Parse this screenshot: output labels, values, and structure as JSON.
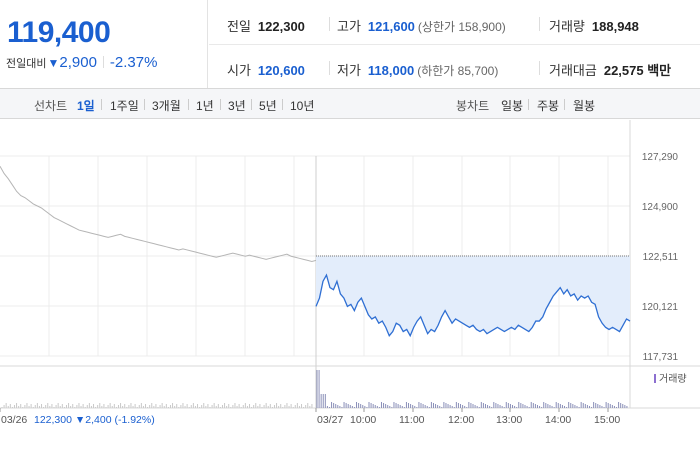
{
  "quote": {
    "price": "119,400",
    "change_label": "전일대비",
    "change_arrow": "▼",
    "change_amount": "2,900",
    "change_percent": "-2.37%"
  },
  "stats": {
    "prev_close": {
      "label": "전일",
      "value": "122,300"
    },
    "high": {
      "label": "고가",
      "value": "121,600",
      "sub": "(상한가 158,900)"
    },
    "volume": {
      "label": "거래량",
      "value": "188,948"
    },
    "open": {
      "label": "시가",
      "value": "120,600"
    },
    "low": {
      "label": "저가",
      "value": "118,000",
      "sub": "(하한가 85,700)"
    },
    "trade_value": {
      "label": "거래대금",
      "value": "22,575 백만"
    }
  },
  "period_bar": {
    "line_label": "선차트",
    "line_options": [
      "1일",
      "1주일",
      "3개월",
      "1년",
      "3년",
      "5년",
      "10년"
    ],
    "active_line_option": "1일",
    "candle_label": "봉차트",
    "candle_options": [
      "일봉",
      "주봉",
      "월봉"
    ]
  },
  "chart_data": {
    "type": "line",
    "y_ticks": [
      "127,290",
      "124,900",
      "122,511",
      "120,121",
      "117,731"
    ],
    "ylim": [
      117731,
      127290
    ],
    "reference_line": 122511,
    "x_labels": [
      "03/26",
      "03/27",
      "10:00",
      "11:00",
      "12:00",
      "13:00",
      "14:00",
      "15:00"
    ],
    "prev_day_summary": {
      "price": "122,300",
      "arrow": "▼",
      "change": "2,400",
      "percent": "(-1.92%)"
    },
    "volume_legend": "거래량",
    "series": [
      {
        "values_prev_day": [
          126800,
          126450,
          126200,
          125900,
          125600,
          125400,
          125300,
          125150,
          125000,
          124900,
          124800,
          124650,
          124500,
          124350,
          124250,
          124150,
          124050,
          123950,
          123850,
          123750,
          123700,
          123650,
          123600,
          123550,
          123500,
          123450,
          123400,
          123450,
          123500,
          123550,
          123450,
          123400,
          123350,
          123300,
          123250,
          123200,
          123150,
          123100,
          123050,
          123000,
          122950,
          122900,
          122850,
          122800,
          122850,
          122800,
          122750,
          122700,
          122650,
          122600,
          122550,
          122500,
          122450,
          122500,
          122550,
          122600,
          122650,
          122600,
          122550,
          122500,
          122550,
          122500,
          122450,
          122400,
          122350,
          122400,
          122450,
          122500,
          122550,
          122600,
          122500,
          122450,
          122400,
          122350,
          122300,
          122250,
          122300
        ],
        "values_today": [
          120100,
          120500,
          121300,
          121600,
          121000,
          120900,
          121300,
          120700,
          120500,
          120100,
          120200,
          119900,
          120300,
          120500,
          120100,
          119700,
          119500,
          119600,
          119300,
          119400,
          119100,
          118700,
          118900,
          119300,
          119200,
          118900,
          119000,
          118700,
          119100,
          119400,
          119600,
          119200,
          118800,
          119000,
          118900,
          119200,
          119600,
          119900,
          119600,
          119300,
          119500,
          119400,
          119300,
          119200,
          119100,
          119200,
          119000,
          118900,
          119000,
          118800,
          118900,
          119000,
          119100,
          119000,
          118900,
          119000,
          119100,
          119000,
          119200,
          119100,
          119000,
          118900,
          119100,
          119400,
          119400,
          119600,
          120000,
          120300,
          120600,
          120800,
          121000,
          120700,
          120900,
          120600,
          120700,
          120400,
          120600,
          120500,
          120600,
          120300,
          120200,
          119600,
          119300,
          119100,
          119000,
          119100,
          119000,
          118900,
          119200,
          119500,
          119400
        ]
      }
    ]
  }
}
